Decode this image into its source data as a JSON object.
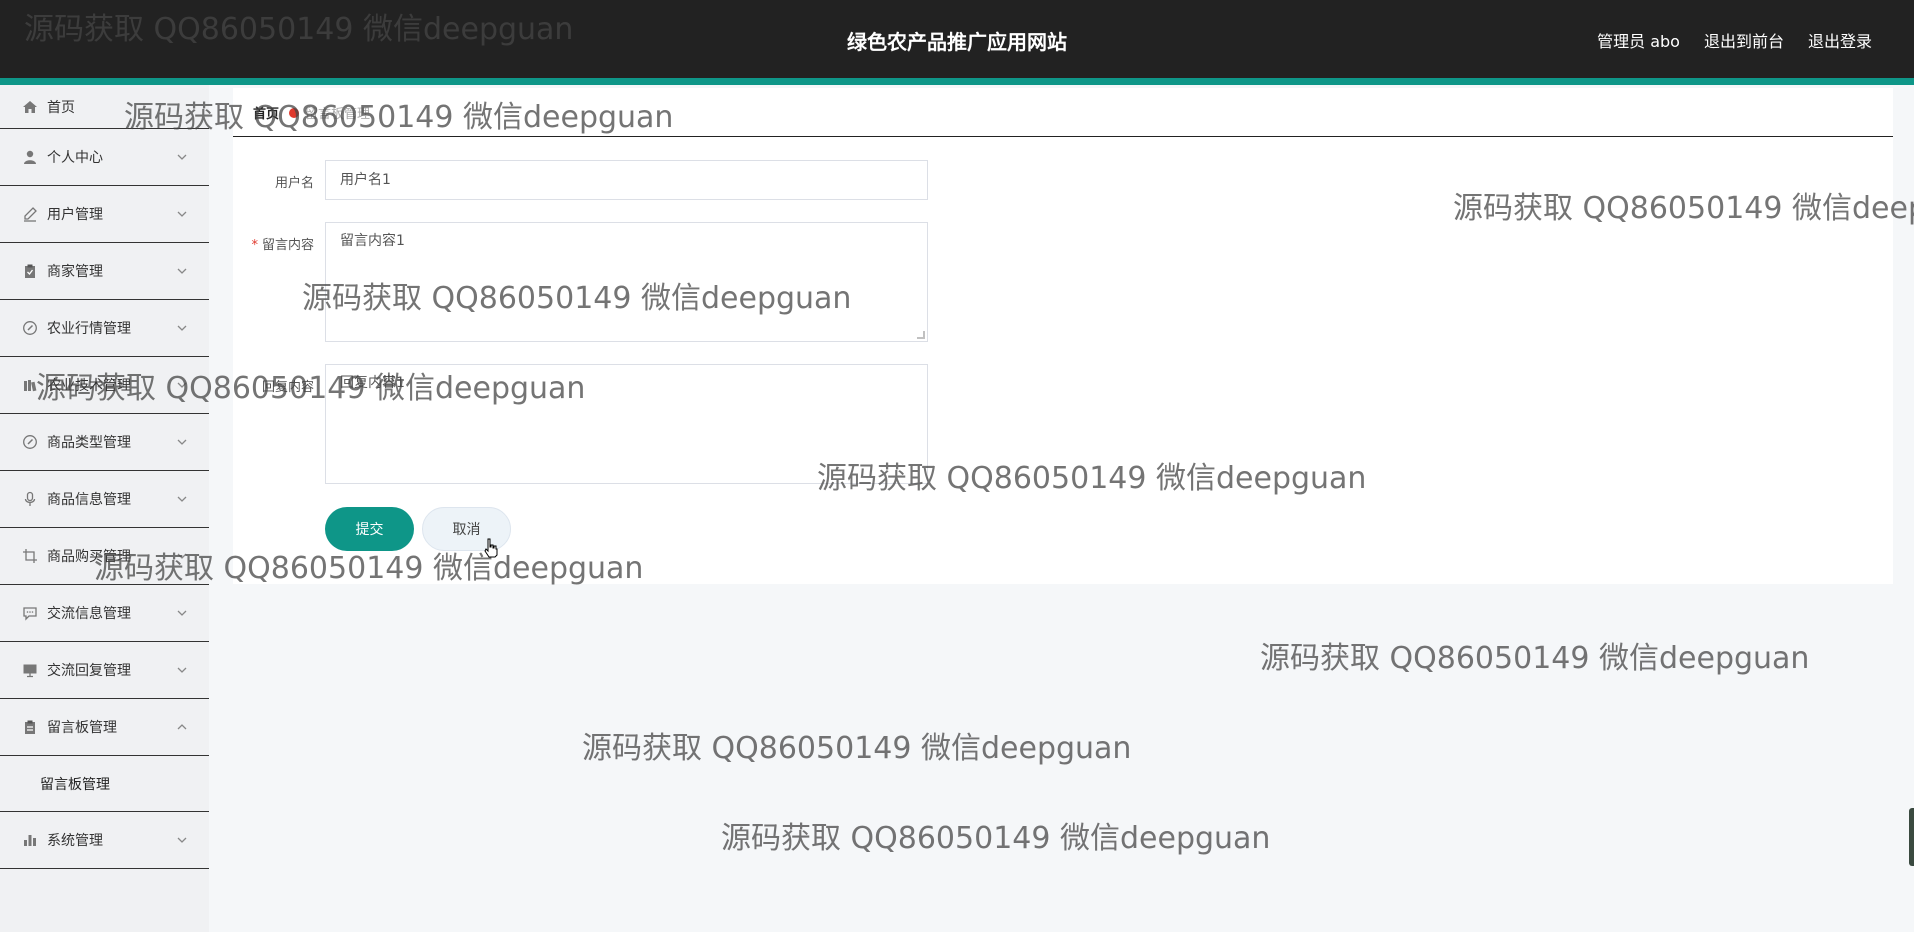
{
  "header": {
    "site_title": "绿色农产品推广应用网站",
    "links": [
      "管理员 abo",
      "退出到前台",
      "退出登录"
    ]
  },
  "sidebar": {
    "items": [
      {
        "label": "首页",
        "icon": "home-icon",
        "chevron": false
      },
      {
        "label": "个人中心",
        "icon": "user-icon",
        "chevron": "down"
      },
      {
        "label": "用户管理",
        "icon": "edit-icon",
        "chevron": "down"
      },
      {
        "label": "商家管理",
        "icon": "clipboard-icon",
        "chevron": "down"
      },
      {
        "label": "农业行情管理",
        "icon": "compass-icon",
        "chevron": "down"
      },
      {
        "label": "农业技术管理",
        "icon": "library-icon",
        "chevron": "down"
      },
      {
        "label": "商品类型管理",
        "icon": "compass-icon",
        "chevron": "down"
      },
      {
        "label": "商品信息管理",
        "icon": "microphone-icon",
        "chevron": "down"
      },
      {
        "label": "商品购买管理",
        "icon": "crop-icon",
        "chevron": "down"
      },
      {
        "label": "交流信息管理",
        "icon": "chat-icon",
        "chevron": "down"
      },
      {
        "label": "交流回复管理",
        "icon": "monitor-icon",
        "chevron": "down"
      },
      {
        "label": "留言板管理",
        "icon": "clipboard-icon",
        "chevron": "up"
      }
    ],
    "submenu": [
      "留言板管理"
    ],
    "last_item": {
      "label": "系统管理",
      "icon": "bar-chart-icon",
      "chevron": "down"
    }
  },
  "breadcrumb": {
    "home": "首页",
    "current": "留言板管理"
  },
  "form": {
    "username_label": "用户名",
    "username_value": "用户名1",
    "content_label": "留言内容",
    "content_value": "留言内容1",
    "reply_label": "回复内容",
    "reply_value": "回复内容1",
    "submit_label": "提交",
    "cancel_label": "取消"
  },
  "watermark_text": "源码获取 QQ86050149 微信deepguan",
  "colors": {
    "accent": "#0e9688",
    "header_bg": "#222222",
    "required": "#e0382c"
  }
}
